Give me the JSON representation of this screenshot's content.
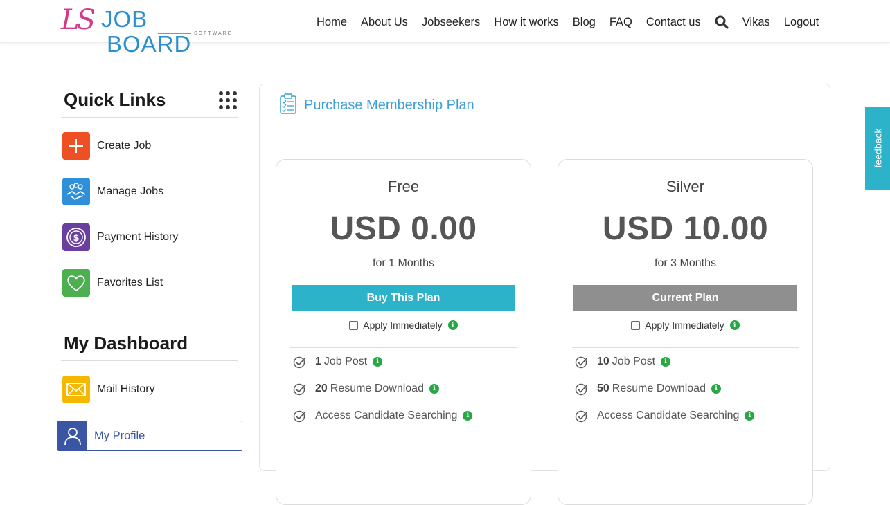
{
  "brand": {
    "mark": "LS",
    "name_job": "JOB",
    "name_board": "BOARD",
    "sub": "SOFTWARE"
  },
  "nav": {
    "items": [
      "Home",
      "About Us",
      "Jobseekers",
      "How it works",
      "Blog",
      "FAQ",
      "Contact us"
    ],
    "user": "Vikas",
    "logout": "Logout"
  },
  "sidebar": {
    "quick_links_title": "Quick Links",
    "quick_links": [
      {
        "label": "Create Job",
        "icon": "plus-icon",
        "color": "#ef5023"
      },
      {
        "label": "Manage Jobs",
        "icon": "handshake-icon",
        "color": "#2f8fd8"
      },
      {
        "label": "Payment History",
        "icon": "dollar-coin-icon",
        "color": "#6a3fa0"
      },
      {
        "label": "Favorites List",
        "icon": "heart-icon",
        "color": "#4caf50"
      }
    ],
    "dashboard_title": "My Dashboard",
    "dashboard": [
      {
        "label": "Mail History",
        "icon": "envelope-icon",
        "color": "#f5b800"
      }
    ],
    "profile_label": "My Profile"
  },
  "panel": {
    "title": "Purchase Membership Plan"
  },
  "plans": [
    {
      "name": "Free",
      "price": "USD 0.00",
      "duration": "for 1 Months",
      "button": "Buy This Plan",
      "apply": "Apply Immediately",
      "features": [
        {
          "count": "1",
          "text": "Job Post"
        },
        {
          "count": "20",
          "text": "Resume Download"
        },
        {
          "count": "",
          "text": "Access Candidate Searching"
        }
      ]
    },
    {
      "name": "Silver",
      "price": "USD 10.00",
      "duration": "for 3 Months",
      "button": "Current Plan",
      "apply": "Apply Immediately",
      "features": [
        {
          "count": "10",
          "text": "Job Post"
        },
        {
          "count": "50",
          "text": "Resume Download"
        },
        {
          "count": "",
          "text": "Access Candidate Searching"
        }
      ]
    }
  ],
  "info_glyph": "i",
  "feedback": "feedback",
  "colors": {
    "accent": "#2db3c9",
    "title_blue": "#3d9fd6",
    "profile_blue": "#3a55a4",
    "current_gray": "#8f8f8f",
    "info_green": "#27a844"
  }
}
